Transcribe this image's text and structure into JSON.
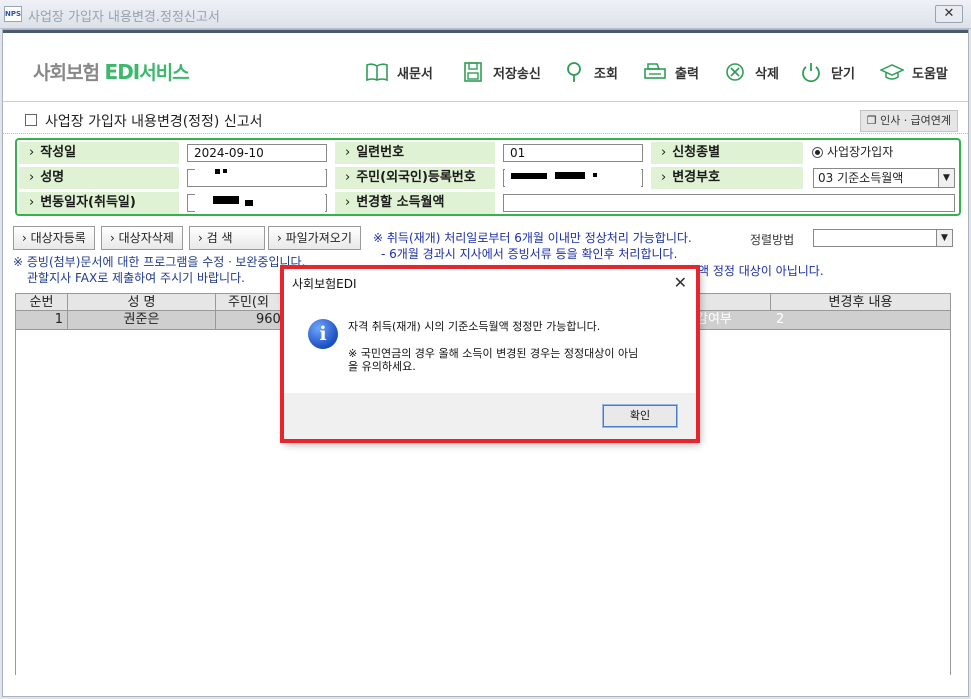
{
  "window": {
    "title": "사업장 가입자 내용변경.정정신고서",
    "app_badge": "NPS"
  },
  "toolbar": {
    "logo_prefix": "사회보험",
    "logo_edi": "EDI",
    "logo_suffix": "서비스",
    "buttons": [
      {
        "label": "새문서",
        "icon": "book-icon"
      },
      {
        "label": "저장송신",
        "icon": "save-icon"
      },
      {
        "label": "조회",
        "icon": "search-pin-icon"
      },
      {
        "label": "출력",
        "icon": "printer-icon"
      },
      {
        "label": "삭제",
        "icon": "delete-circle-icon"
      },
      {
        "label": "닫기",
        "icon": "power-icon"
      },
      {
        "label": "도움말",
        "icon": "graduation-cap-icon"
      }
    ]
  },
  "form": {
    "title": "사업장 가입자 내용변경(정정) 신고서",
    "hr_link": "인사ㆍ급여연계",
    "labels": {
      "write_date": "작성일",
      "serial": "일련번호",
      "report_type": "신청종별",
      "name": "성명",
      "resident_no": "주민(외국인)등록번호",
      "change_code": "변경부호",
      "change_date": "변동일자(취득일)",
      "change_income": "변경할 소득월액"
    },
    "values": {
      "write_date": "2024-09-10",
      "serial": "01",
      "report_type": "사업장가입자",
      "change_code": "03    기준소득월액",
      "change_income": ""
    }
  },
  "actions": {
    "register": "대상자등록",
    "delete": "대상자삭제",
    "search": "검    색",
    "import": "파일가져오기",
    "sort_label": "정렬방법",
    "sort_value": ""
  },
  "notices": {
    "line1": "※ 취득(재개) 처리일로부터 6개월 이내만 정상처리 가능합니다.",
    "line2": "- 6개월 경과시 지사에서 증빙서류 등을 확인후 처리합니다.",
    "line3_tail": "액 정정 대상이 아닙니다.",
    "line4": "※ 증빙(첨부)문서에 대한 프로그램을 수정ㆍ보완중입니다.",
    "line5": "관할지사 FAX로 제출하여 주시기 바랍니다."
  },
  "table": {
    "headers": [
      "순번",
      "성  명",
      "주민(외",
      "변경후 내용"
    ],
    "row": {
      "seq": "1",
      "name": "권준은",
      "resident_no": "9603",
      "partial": "감여부",
      "value": "2"
    }
  },
  "dialog": {
    "title": "사회보험EDI",
    "message1": "자격 취득(재개) 시의 기준소득월액 정정만 가능합니다.",
    "message2": "※ 국민연금의 경우 올해 소득이 변경된 경우는 정정대상이 아님",
    "message3": "을 유의하세요.",
    "ok": "확인"
  },
  "colors": {
    "accent_green": "#35b24a",
    "label_bg": "#dff2d4",
    "highlight_red": "#e5262d",
    "notice_blue": "#1a2fa8"
  }
}
